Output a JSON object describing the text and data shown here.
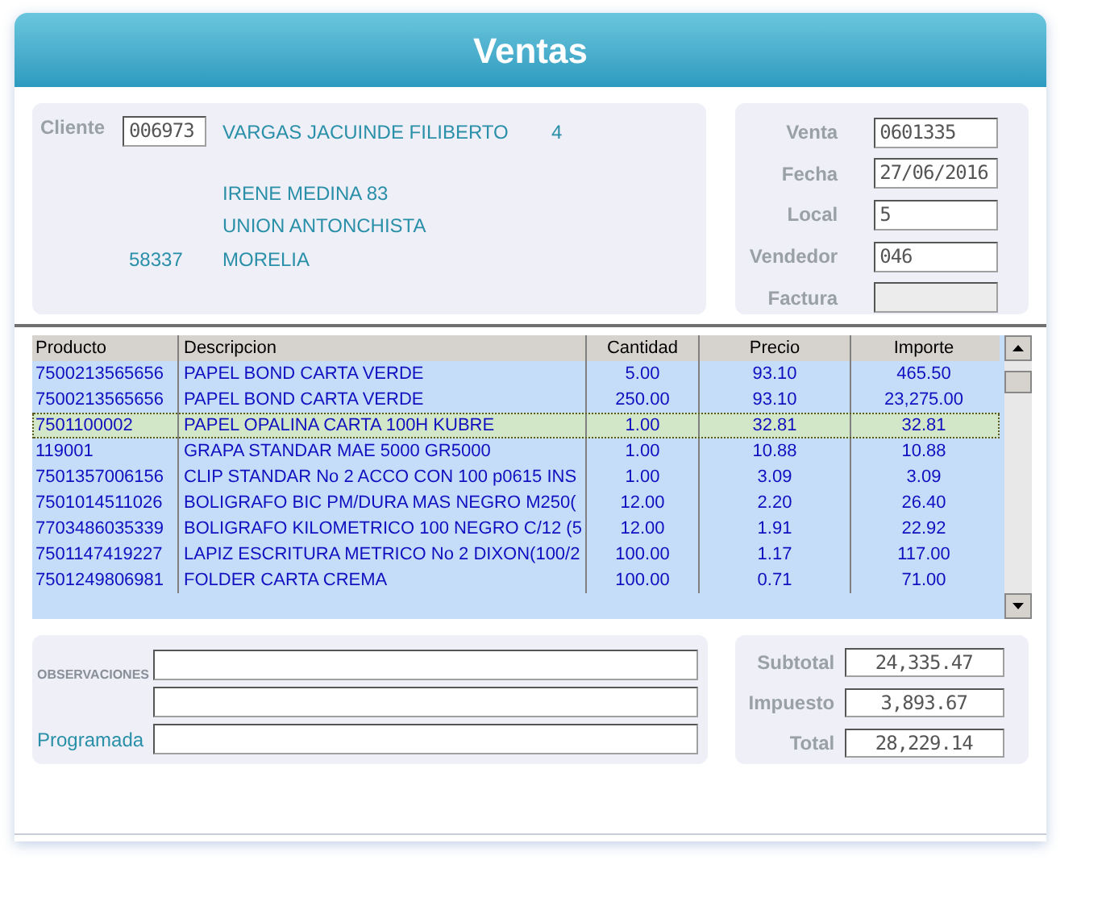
{
  "window": {
    "title": "Ventas"
  },
  "cliente": {
    "label": "Cliente",
    "code": "006973",
    "name": "VARGAS JACUINDE FILIBERTO",
    "number": "4",
    "address_1": "IRENE MEDINA 83",
    "address_2": "UNION ANTONCHISTA",
    "zip": "58337",
    "city": "MORELIA"
  },
  "venta_fields": [
    {
      "label": "Venta",
      "value": "0601335",
      "disabled": false
    },
    {
      "label": "Fecha",
      "value": "27/06/2016",
      "disabled": false
    },
    {
      "label": "Local",
      "value": "5",
      "disabled": false
    },
    {
      "label": "Vendedor",
      "value": "046",
      "disabled": false
    },
    {
      "label": "Factura",
      "disabled": true
    }
  ],
  "table": {
    "columns": [
      "Producto",
      "Descripcion",
      "Cantidad",
      "Precio",
      "Importe"
    ],
    "rows": [
      {
        "cells": [
          "7500213565656",
          "PAPEL BOND CARTA VERDE",
          "5.00",
          "93.10",
          "465.50"
        ],
        "selected": false
      },
      {
        "cells": [
          "7500213565656",
          "PAPEL BOND CARTA VERDE",
          "250.00",
          "93.10",
          "23,275.00"
        ],
        "selected": false
      },
      {
        "cells": [
          "7501100002",
          "PAPEL OPALINA CARTA 100H KUBRE",
          "1.00",
          "32.81",
          "32.81"
        ],
        "selected": true
      },
      {
        "cells": [
          "119001",
          "GRAPA STANDAR MAE 5000 GR5000",
          "1.00",
          "10.88",
          "10.88"
        ],
        "selected": false
      },
      {
        "cells": [
          "7501357006156",
          "CLIP STANDAR No 2 ACCO CON 100 p0615 INS",
          "1.00",
          "3.09",
          "3.09"
        ],
        "selected": false
      },
      {
        "cells": [
          "7501014511026",
          "BOLIGRAFO BIC PM/DURA MAS NEGRO M250(",
          "12.00",
          "2.20",
          "26.40"
        ],
        "selected": false
      },
      {
        "cells": [
          "7703486035339",
          "BOLIGRAFO KILOMETRICO 100 NEGRO C/12 (5",
          "12.00",
          "1.91",
          "22.92"
        ],
        "selected": false
      },
      {
        "cells": [
          "7501147419227",
          "LAPIZ ESCRITURA METRICO No 2 DIXON(100/2",
          "100.00",
          "1.17",
          "117.00"
        ],
        "selected": false
      },
      {
        "cells": [
          "7501249806981",
          "FOLDER CARTA CREMA",
          "100.00",
          "0.71",
          "71.00"
        ],
        "selected": false
      }
    ]
  },
  "observaciones": {
    "label": "OBSERVACIONES",
    "programada_label": "Programada"
  },
  "totals": [
    {
      "label": "Subtotal",
      "value": "24,335.47"
    },
    {
      "label": "Impuesto",
      "value": "3,893.67"
    },
    {
      "label": "Total",
      "value": "28,229.14"
    }
  ]
}
